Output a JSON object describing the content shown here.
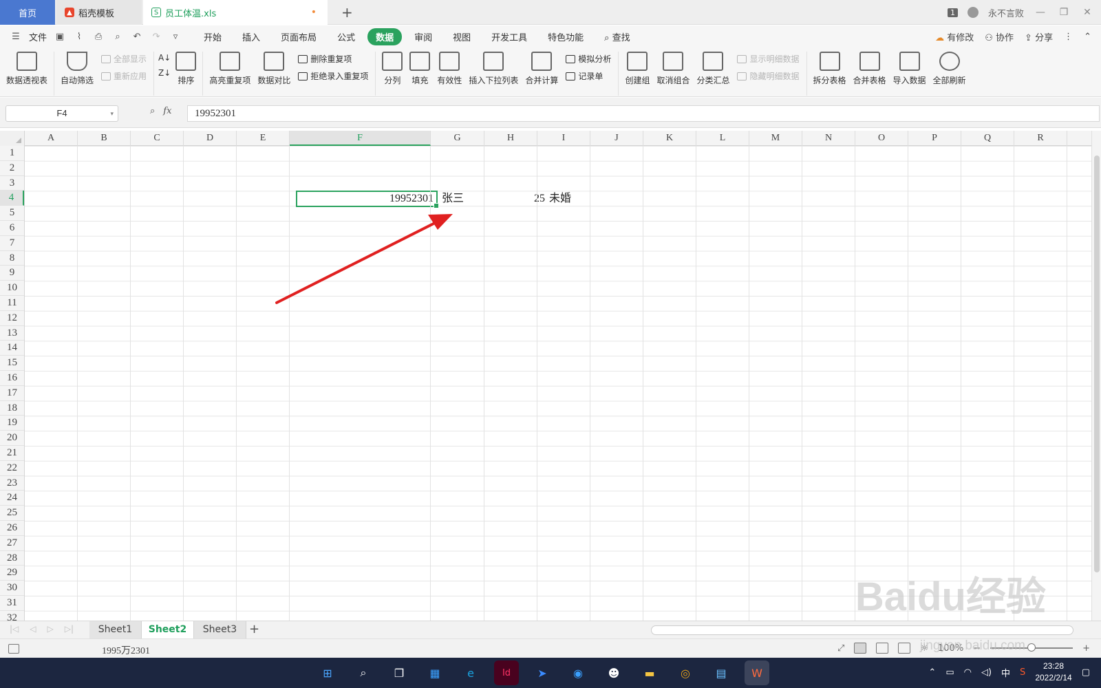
{
  "tabs": {
    "home": "首页",
    "template": "稻壳模板",
    "file": "员工体温.xls",
    "unsaved_marker": "•"
  },
  "titlebar": {
    "window_count": "1",
    "user": "永不言败"
  },
  "menu": {
    "file": "文件",
    "tabs": [
      "开始",
      "插入",
      "页面布局",
      "公式",
      "数据",
      "审阅",
      "视图",
      "开发工具",
      "特色功能"
    ],
    "active_tab": "数据",
    "search": "查找",
    "right": {
      "edits": "有修改",
      "collab": "协作",
      "share": "分享"
    }
  },
  "ribbon": {
    "pivot": "数据透视表",
    "autofilter": "自动筛选",
    "show_all": "全部显示",
    "reapply": "重新应用",
    "sort": "排序",
    "highlight_dup": "高亮重复项",
    "compare": "数据对比",
    "delete_dup": "删除重复项",
    "reject_dup": "拒绝录入重复项",
    "split_col": "分列",
    "fill": "填充",
    "validity": "有效性",
    "insert_dropdown": "插入下拉列表",
    "consolidate": "合并计算",
    "whatif": "模拟分析",
    "record_form": "记录单",
    "group": "创建组",
    "ungroup": "取消组合",
    "subtotal": "分类汇总",
    "show_detail": "显示明细数据",
    "hide_detail": "隐藏明细数据",
    "split_table": "拆分表格",
    "merge_table": "合并表格",
    "import": "导入数据",
    "refresh_all": "全部刷新"
  },
  "formula_bar": {
    "name_box": "F4",
    "fx": "fx",
    "content": "19952301"
  },
  "grid": {
    "columns": [
      "A",
      "B",
      "C",
      "D",
      "E",
      "F",
      "G",
      "H",
      "I",
      "J",
      "K",
      "L",
      "M",
      "N",
      "O",
      "P",
      "Q",
      "R"
    ],
    "active_column": "F",
    "rows": [
      "1",
      "2",
      "3",
      "4",
      "5",
      "6",
      "7",
      "8",
      "9",
      "10",
      "11",
      "12",
      "13",
      "14",
      "15",
      "16",
      "17",
      "18",
      "19",
      "20",
      "21",
      "22",
      "23",
      "24",
      "25",
      "26",
      "27",
      "28",
      "29",
      "30",
      "31",
      "32"
    ],
    "active_row": "4",
    "cells": {
      "F4": "19952301",
      "G4": "张三",
      "H4": "25",
      "I4": "未婚"
    }
  },
  "sheets": [
    "Sheet1",
    "Sheet2",
    "Sheet3"
  ],
  "active_sheet": "Sheet2",
  "status": {
    "text": "1995万2301",
    "zoom": "100%"
  },
  "taskbar": {
    "ime": "中",
    "time": "23:28",
    "date": "2022/2/14"
  },
  "watermark": {
    "text": "Baidu经验",
    "url": "jingyan.baidu.com"
  },
  "colors": {
    "accent": "#2aa25e",
    "home_tab": "#4a78d0",
    "arrow": "#e02020"
  }
}
